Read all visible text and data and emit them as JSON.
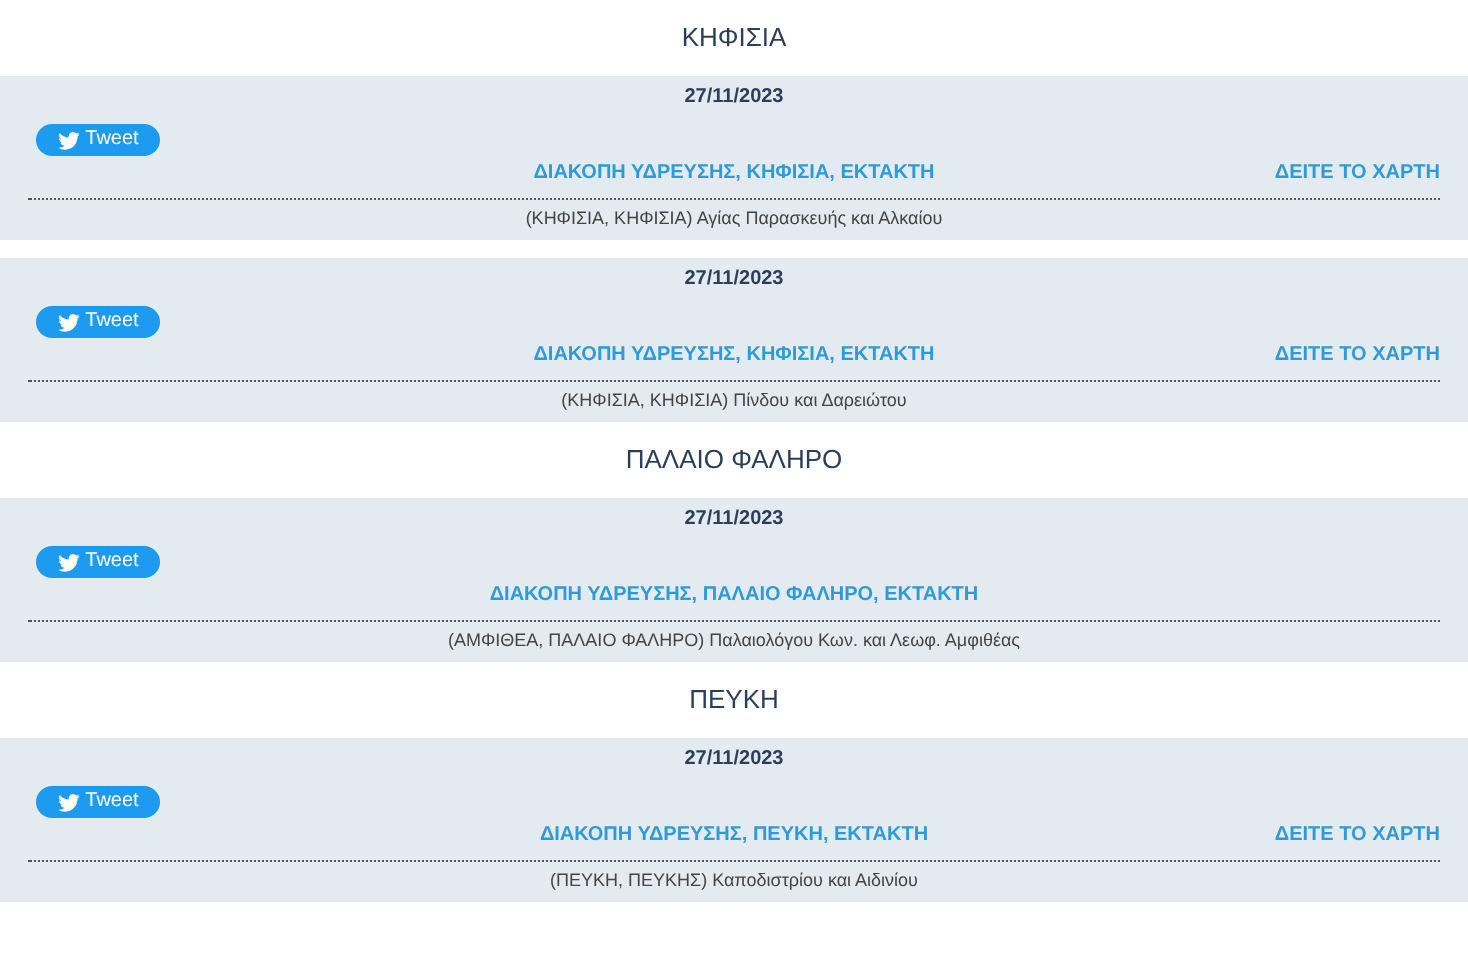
{
  "sections": [
    {
      "heading": "ΚΗΦΙΣΙΑ",
      "entries": [
        {
          "date": "27/11/2023",
          "tweet": "Tweet",
          "title": "ΔΙΑΚΟΠΗ ΥΔΡΕΥΣΗΣ, ΚΗΦΙΣΙΑ, ΕΚΤΑΚΤΗ",
          "map_link": "ΔΕΙΤΕ ΤΟ ΧΑΡΤΗ",
          "address": "(ΚΗΦΙΣΙΑ, ΚΗΦΙΣΙΑ) Αγίας Παρασκευής και Αλκαίου"
        },
        {
          "date": "27/11/2023",
          "tweet": "Tweet",
          "title": "ΔΙΑΚΟΠΗ ΥΔΡΕΥΣΗΣ, ΚΗΦΙΣΙΑ, ΕΚΤΑΚΤΗ",
          "map_link": "ΔΕΙΤΕ ΤΟ ΧΑΡΤΗ",
          "address": "(ΚΗΦΙΣΙΑ, ΚΗΦΙΣΙΑ) Πίνδου και Δαρειώτου"
        }
      ]
    },
    {
      "heading": "ΠΑΛΑΙΟ ΦΑΛΗΡΟ",
      "entries": [
        {
          "date": "27/11/2023",
          "tweet": "Tweet",
          "title": "ΔΙΑΚΟΠΗ ΥΔΡΕΥΣΗΣ, ΠΑΛΑΙΟ ΦΑΛΗΡΟ, ΕΚΤΑΚΤΗ",
          "address": "(ΑΜΦΙΘΕΑ, ΠΑΛΑΙΟ ΦΑΛΗΡΟ) Παλαιολόγου Κων. και Λεωφ. Αμφιθέας"
        }
      ]
    },
    {
      "heading": "ΠΕΥΚΗ",
      "entries": [
        {
          "date": "27/11/2023",
          "tweet": "Tweet",
          "title": "ΔΙΑΚΟΠΗ ΥΔΡΕΥΣΗΣ, ΠΕΥΚΗ, ΕΚΤΑΚΤΗ",
          "map_link": "ΔΕΙΤΕ ΤΟ ΧΑΡΤΗ",
          "address": "(ΠΕΥΚΗ, ΠΕΥΚΗΣ) Καποδιστρίου και Αιδινίου"
        }
      ]
    }
  ]
}
